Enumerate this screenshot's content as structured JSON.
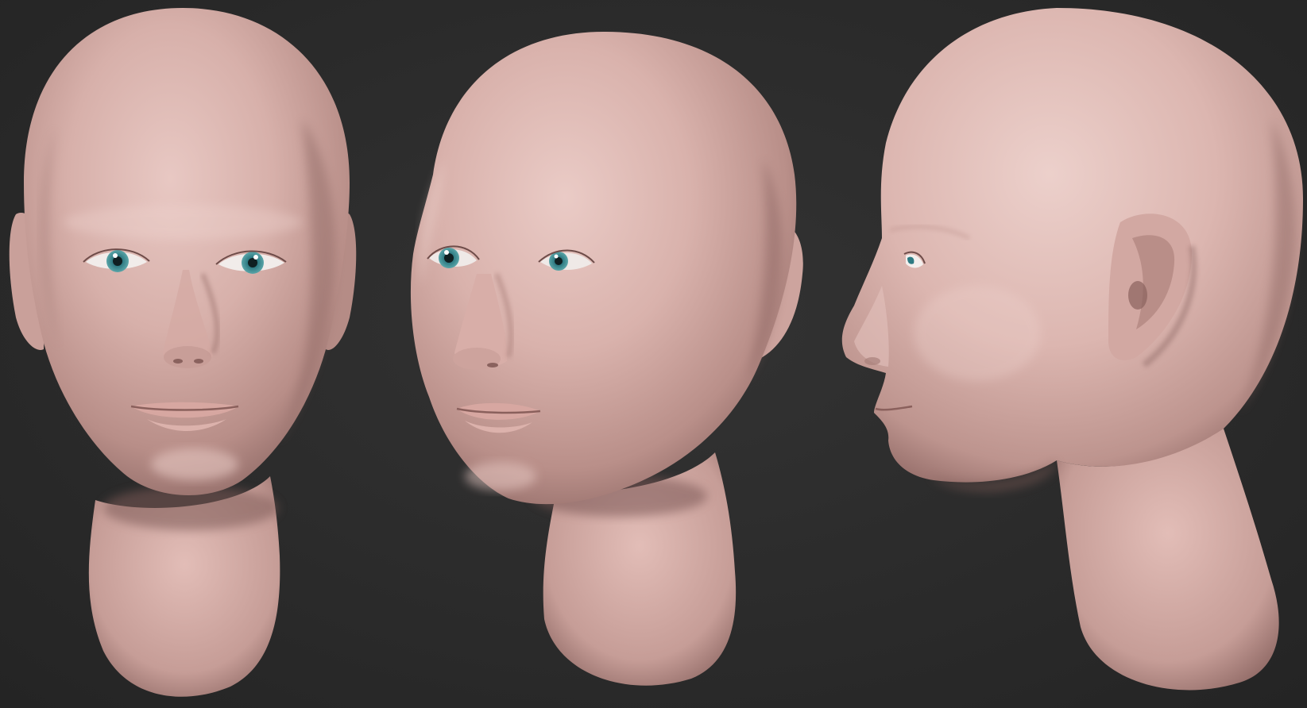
{
  "scene": {
    "background_color": "#2a2a2a",
    "skin_color": "#d9b1ab",
    "iris_color": "#3f8f96",
    "views": [
      {
        "name": "front-view"
      },
      {
        "name": "three-quarter-view"
      },
      {
        "name": "side-profile-view"
      }
    ]
  }
}
